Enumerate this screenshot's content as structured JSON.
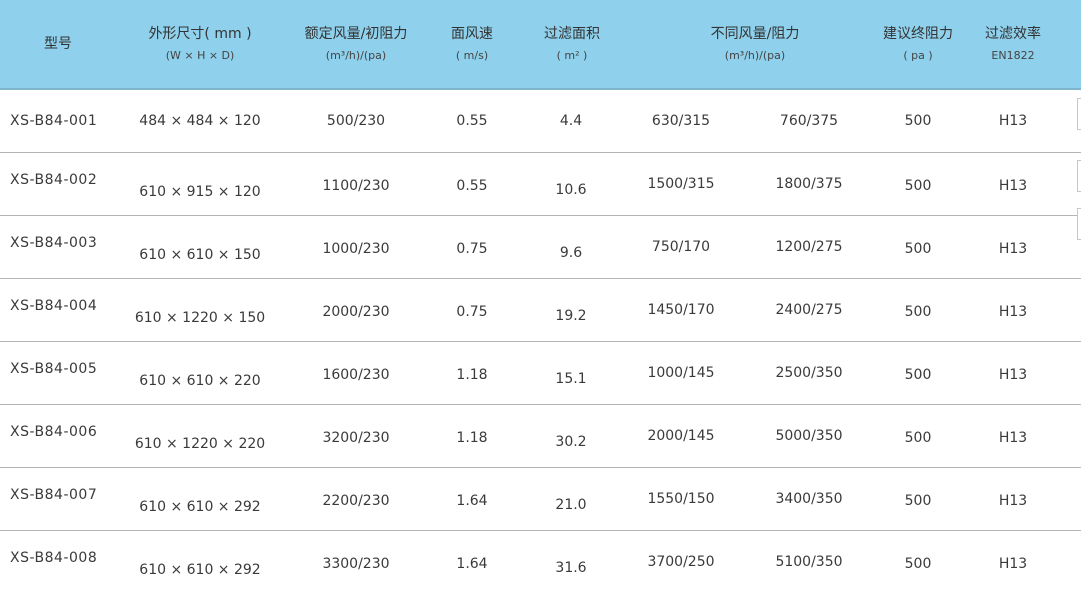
{
  "headers": {
    "model": "型号",
    "size": "外形尺寸( mm )",
    "size_sub": "(W × H × D)",
    "rated": "额定风量/初阻力",
    "rated_sub": "(m³/h)/(pa)",
    "velocity": "面风速",
    "velocity_sub": "( m/s)",
    "area": "过滤面积",
    "area_sub": "( m² )",
    "diff": "不同风量/阻力",
    "diff_sub": "(m³/h)/(pa)",
    "final": "建议终阻力",
    "final_sub": "( pa )",
    "eff": "过滤效率",
    "eff_sub": "EN1822"
  },
  "rows": [
    {
      "model": "XS-B84-001",
      "size": "484 × 484 × 120",
      "rated": "500/230",
      "velocity": "0.55",
      "area": "4.4",
      "diff1": "630/315",
      "diff2": "760/375",
      "final": "500",
      "eff": "H13"
    },
    {
      "model": "XS-B84-002",
      "size": "610 × 915 × 120",
      "rated": "1100/230",
      "velocity": "0.55",
      "area": "10.6",
      "diff1": "1500/315",
      "diff2": "1800/375",
      "final": "500",
      "eff": "H13"
    },
    {
      "model": "XS-B84-003",
      "size": "610 × 610 × 150",
      "rated": "1000/230",
      "velocity": "0.75",
      "area": "9.6",
      "diff1": "750/170",
      "diff2": "1200/275",
      "final": "500",
      "eff": "H13"
    },
    {
      "model": "XS-B84-004",
      "size": "610 × 1220 × 150",
      "rated": "2000/230",
      "velocity": "0.75",
      "area": "19.2",
      "diff1": "1450/170",
      "diff2": "2400/275",
      "final": "500",
      "eff": "H13"
    },
    {
      "model": "XS-B84-005",
      "size": "610 × 610 × 220",
      "rated": "1600/230",
      "velocity": "1.18",
      "area": "15.1",
      "diff1": "1000/145",
      "diff2": "2500/350",
      "final": "500",
      "eff": "H13"
    },
    {
      "model": "XS-B84-006",
      "size": "610 × 1220 × 220",
      "rated": "3200/230",
      "velocity": "1.18",
      "area": "30.2",
      "diff1": "2000/145",
      "diff2": "5000/350",
      "final": "500",
      "eff": "H13"
    },
    {
      "model": "XS-B84-007",
      "size": "610 × 610 × 292",
      "rated": "2200/230",
      "velocity": "1.64",
      "area": "21.0",
      "diff1": "1550/150",
      "diff2": "3400/350",
      "final": "500",
      "eff": "H13"
    },
    {
      "model": "XS-B84-008",
      "size": "610 × 610 × 292",
      "rated": "3300/230",
      "velocity": "1.64",
      "area": "31.6",
      "diff1": "3700/250",
      "diff2": "5100/350",
      "final": "500",
      "eff": "H13"
    }
  ],
  "colors": {
    "header_bg": "#8fd1ec",
    "row_divider": "#b5b5b5",
    "text": "#3a3a3a"
  }
}
